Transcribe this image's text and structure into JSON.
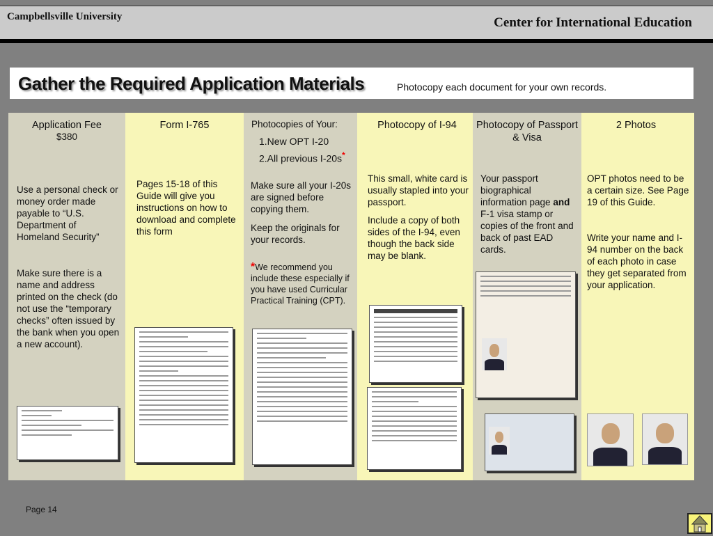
{
  "header": {
    "university": "Campbellsville University",
    "department": "Center for International Education"
  },
  "title": {
    "main": "Gather the Required Application Materials",
    "subtitle": "Photocopy each document for your own records."
  },
  "columns": [
    {
      "title": "Application Fee",
      "subtitle": "$380",
      "body": [
        "Use a personal check or money order made payable to “U.S. Department of Homeland Security”",
        "Make sure there is a name and address printed on the check (do not use the “temporary checks” often issued by the bank when you open a new account)."
      ]
    },
    {
      "title": "Form I-765",
      "body": [
        "Pages 15-18 of this Guide will give you instructions on how to download and complete this form"
      ]
    },
    {
      "title": "Photocopies  of  Your:",
      "list": [
        "1.New OPT I-20",
        "2.All previous I-20s"
      ],
      "asterisk": "*",
      "body": [
        "Make sure all your I-20s are signed before copying them.",
        "Keep the originals for your records."
      ],
      "note": "We recommend you include these especially if you have used Curricular Practical Training (CPT)."
    },
    {
      "title": "Photocopy of I-94",
      "body": [
        "This small, white card is usually stapled into your passport.",
        "Include a copy of both sides of the I-94, even though the back side may be blank."
      ]
    },
    {
      "title": "Photocopy of Passport & Visa",
      "body_pre": "Your passport biographical information page",
      "body_bold": "and",
      "body_post": "F-1 visa stamp or copies of the front and back of past EAD cards."
    },
    {
      "title": "2 Photos",
      "body": [
        "OPT photos need to be a certain size.  See Page 19 of this Guide.",
        "Write your name and I-94 number on the back of each photo in case they get separated from your application."
      ]
    }
  ],
  "footer": {
    "page": "Page 14"
  }
}
